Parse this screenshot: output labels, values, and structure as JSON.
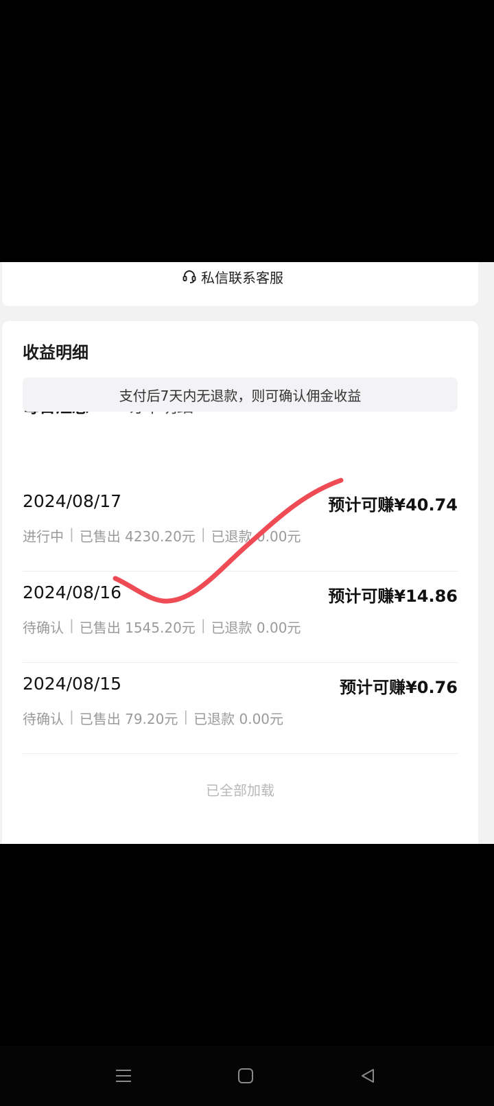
{
  "service": {
    "label": "私信联系客服",
    "icon": "headset-icon"
  },
  "earnings": {
    "title": "收益明细",
    "tabs": [
      {
        "label": "每日汇总",
        "active": true
      },
      {
        "label": "订单明细",
        "active": false
      }
    ],
    "notice": "支付后7天内无退款，则可确认佣金收益",
    "rows": [
      {
        "date": "2024/08/17",
        "earn": "预计可赚¥40.74",
        "status": "进行中",
        "sold": "已售出 4230.20元",
        "refund": "已退款 0.00元"
      },
      {
        "date": "2024/08/16",
        "earn": "预计可赚¥14.86",
        "status": "待确认",
        "sold": "已售出 1545.20元",
        "refund": "已退款 0.00元"
      },
      {
        "date": "2024/08/15",
        "earn": "预计可赚¥0.76",
        "status": "待确认",
        "sold": "已售出 79.20元",
        "refund": "已退款 0.00元"
      }
    ],
    "separator": "|",
    "footer": "已全部加载"
  },
  "annotation": {
    "color": "#ef4b55"
  },
  "navbar": {
    "icons": [
      "menu-icon",
      "home-icon",
      "back-icon"
    ]
  }
}
